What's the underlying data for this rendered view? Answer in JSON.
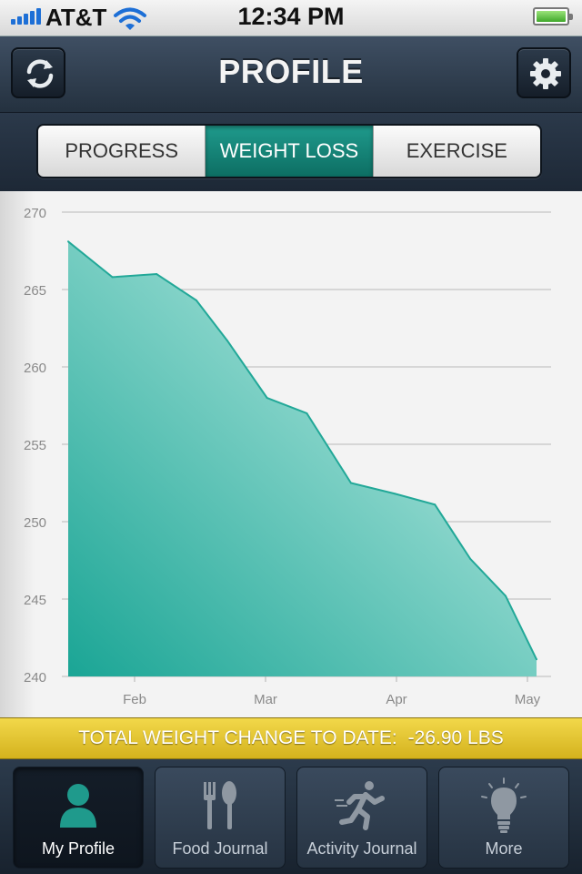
{
  "status_bar": {
    "carrier": "AT&T",
    "time": "12:34 PM",
    "icons": [
      "signal-icon",
      "wifi-icon",
      "battery-icon"
    ]
  },
  "nav_bar": {
    "title": "PROFILE",
    "left_icon": "refresh-icon",
    "right_icon": "gear-icon"
  },
  "segments": [
    {
      "label": "PROGRESS",
      "active": false
    },
    {
      "label": "WEIGHT LOSS",
      "active": true
    },
    {
      "label": "EXERCISE",
      "active": false
    }
  ],
  "chart_data": {
    "type": "area",
    "ylim": [
      240,
      270
    ],
    "yticks": [
      270,
      265,
      260,
      255,
      250,
      245,
      240
    ],
    "xticks": [
      "Feb",
      "Mar",
      "Apr",
      "May"
    ],
    "grid": true,
    "color": "#22a898",
    "x": [
      0,
      0.5,
      1,
      1.45,
      1.8,
      2.25,
      2.7,
      3.2,
      3.7,
      4.15,
      4.55,
      4.95,
      5.3
    ],
    "values": [
      268.1,
      265.8,
      266.0,
      264.3,
      261.7,
      258.0,
      257.0,
      252.5,
      251.8,
      251.1,
      247.6,
      245.2,
      241.1
    ]
  },
  "total": {
    "label": "TOTAL WEIGHT CHANGE TO DATE:",
    "value": "-26.90 LBS"
  },
  "tabs": [
    {
      "label": "My Profile",
      "icon": "person-icon",
      "active": true
    },
    {
      "label": "Food Journal",
      "icon": "fork-spoon-icon",
      "active": false
    },
    {
      "label": "Activity Journal",
      "icon": "runner-icon",
      "active": false
    },
    {
      "label": "More",
      "icon": "lightbulb-icon",
      "active": false
    }
  ],
  "colors": {
    "accent": "#1f9a8c",
    "highlight_bar": "#e8c82e",
    "nav_bg": "#2f3d4e"
  }
}
